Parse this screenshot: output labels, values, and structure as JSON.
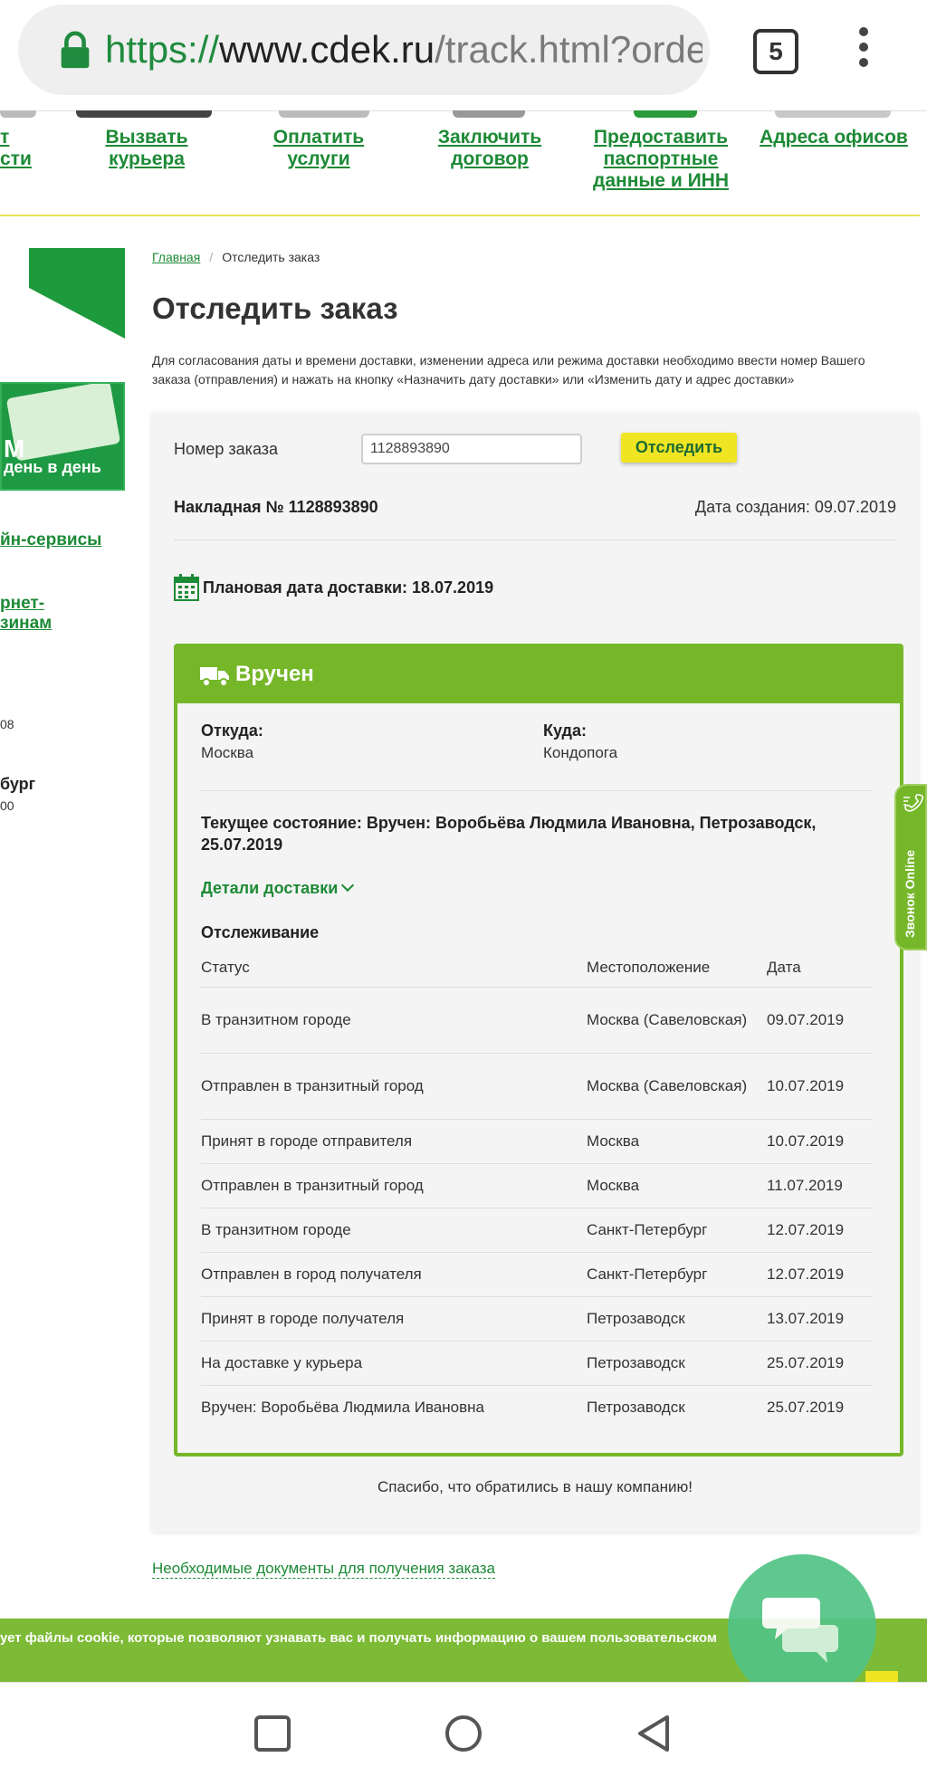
{
  "browser": {
    "url_scheme": "https://",
    "url_host": "www.cdek.ru",
    "url_path": "/track.html?orde",
    "tab_count": "5"
  },
  "top_nav": {
    "partial_left": "т\nсти",
    "items": [
      {
        "label": "Вызвать\nкурьера"
      },
      {
        "label": "Оплатить\nуслуги"
      },
      {
        "label": "Заключить\nдоговор"
      },
      {
        "label": "Предоставить\nпаспортные\nданные и ИНН"
      },
      {
        "label": "Адреса офисов"
      }
    ]
  },
  "sidebar": {
    "promo_big": "M",
    "promo_line": "день в день",
    "link1": "йн-сервисы",
    "link2_line1": "рнет-",
    "link2_line2": "зинам",
    "text1": "08",
    "city": "бург",
    "text2": "00"
  },
  "breadcrumb": {
    "home": "Главная",
    "separator": "/",
    "current": "Отследить заказ"
  },
  "page_title": "Отследить заказ",
  "intro_text": "Для согласования даты и времени доставки, изменении адреса или режима доставки необходимо ввести номер Вашего заказа (отправления) и нажать на кнопку «Назначить дату доставки» или «Изменить дату и адрес доставки»",
  "tracking_form": {
    "label": "Номер заказа",
    "value": "1128893890",
    "button": "Отследить"
  },
  "waybill": "Накладная № 1128893890",
  "created_date": "Дата создания: 09.07.2019",
  "planned_delivery": "Плановая дата доставки: 18.07.2019",
  "status_card": {
    "title": "Вручен",
    "from_label": "Откуда:",
    "from_value": "Москва",
    "to_label": "Куда:",
    "to_value": "Кондопога",
    "current_state": "Текущее состояние: Вручен: Воробьёва Людмила Ивановна, Петрозаводск, 25.07.2019",
    "details_link": "Детали доставки",
    "tracking_heading": "Отслеживание",
    "columns": {
      "status": "Статус",
      "location": "Местоположение",
      "date": "Дата"
    },
    "rows": [
      {
        "status": "В транзитном городе",
        "location": "Москва (Савеловская)",
        "date": "09.07.2019"
      },
      {
        "status": "Отправлен в транзитный город",
        "location": "Москва (Савеловская)",
        "date": "10.07.2019"
      },
      {
        "status": "Принят в городе отправителя",
        "location": "Москва",
        "date": "10.07.2019"
      },
      {
        "status": "Отправлен в транзитный город",
        "location": "Москва",
        "date": "11.07.2019"
      },
      {
        "status": "В транзитном городе",
        "location": "Санкт-Петербург",
        "date": "12.07.2019"
      },
      {
        "status": "Отправлен в город получателя",
        "location": "Санкт-Петербург",
        "date": "12.07.2019"
      },
      {
        "status": "Принят в городе получателя",
        "location": "Петрозаводск",
        "date": "13.07.2019"
      },
      {
        "status": "На доставке у курьера",
        "location": "Петрозаводск",
        "date": "25.07.2019"
      },
      {
        "status": "Вручен: Воробьёва Людмила Ивановна",
        "location": "Петрозаводск",
        "date": "25.07.2019"
      }
    ]
  },
  "thanks_text": "Спасибо, что обратились в нашу компанию!",
  "docs_link": "Необходимые документы для получения заказа",
  "callback_tab": "Звонок Online",
  "cookie_text": "ует файлы cookie, которые позволяют узнавать вас и получать информацию о вашем пользовательском",
  "colors": {
    "brand_green": "#1d8a36",
    "status_green": "#76b72a",
    "button_yellow": "#f0e522"
  },
  "icons": [
    "lock-icon",
    "tabs-icon",
    "more-vert-icon",
    "calendar-icon",
    "truck-icon",
    "chevron-down-icon",
    "phone-icon",
    "chat-icon",
    "square-icon",
    "circle-icon",
    "triangle-back-icon"
  ]
}
